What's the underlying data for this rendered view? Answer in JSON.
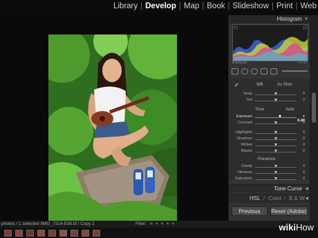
{
  "modules": {
    "items": [
      "Library",
      "Develop",
      "Map",
      "Book",
      "Slideshow",
      "Print",
      "Web"
    ],
    "active": "Develop"
  },
  "panel": {
    "histogram_title": "Histogram",
    "hist_info_left": "Exposure",
    "hist_info_right": "+ 0.40",
    "basic": {
      "wb_label": "WB",
      "wb_value": "As Shot",
      "temp_label": "Temp",
      "tint_label": "Tint",
      "tone_label": "Tone",
      "auto_label": "Auto",
      "exposure_label": "Exposure",
      "exposure_value": "+ 0.40",
      "contrast_label": "Contrast",
      "highlights_label": "Highlights",
      "shadows_label": "Shadows",
      "whites_label": "Whites",
      "blacks_label": "Blacks",
      "presence_label": "Presence",
      "clarity_label": "Clarity",
      "vibrance_label": "Vibrance",
      "saturation_label": "Saturation",
      "zero": "0"
    },
    "tone_curve": "Tone Curve",
    "hsl": "HSL",
    "color": "Color",
    "bw": "B & W",
    "previous_button": "Previous",
    "reset_button": "Reset (Adobe)"
  },
  "filmbar": {
    "path": "photos / 1 selected /IMG_7314-Edit.tif / Copy 1",
    "filter_label": "Filter:"
  },
  "watermark": {
    "wiki": "wiki",
    "how": "How"
  },
  "colors": {
    "panel_bg": "#333333",
    "histogram_accent": "#d94f8a"
  }
}
